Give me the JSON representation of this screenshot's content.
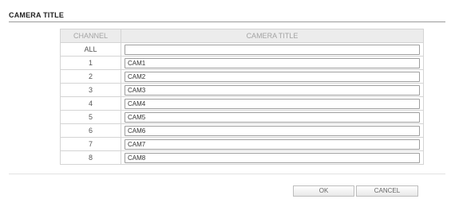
{
  "page": {
    "title": "CAMERA TITLE"
  },
  "table": {
    "headers": {
      "channel": "CHANNEL",
      "camera_title": "CAMERA TITLE"
    },
    "rows": [
      {
        "channel": "ALL",
        "title": ""
      },
      {
        "channel": "1",
        "title": "CAM1"
      },
      {
        "channel": "2",
        "title": "CAM2"
      },
      {
        "channel": "3",
        "title": "CAM3"
      },
      {
        "channel": "4",
        "title": "CAM4"
      },
      {
        "channel": "5",
        "title": "CAM5"
      },
      {
        "channel": "6",
        "title": "CAM6"
      },
      {
        "channel": "7",
        "title": "CAM7"
      },
      {
        "channel": "8",
        "title": "CAM8"
      }
    ]
  },
  "buttons": {
    "ok": "OK",
    "cancel": "CANCEL"
  }
}
